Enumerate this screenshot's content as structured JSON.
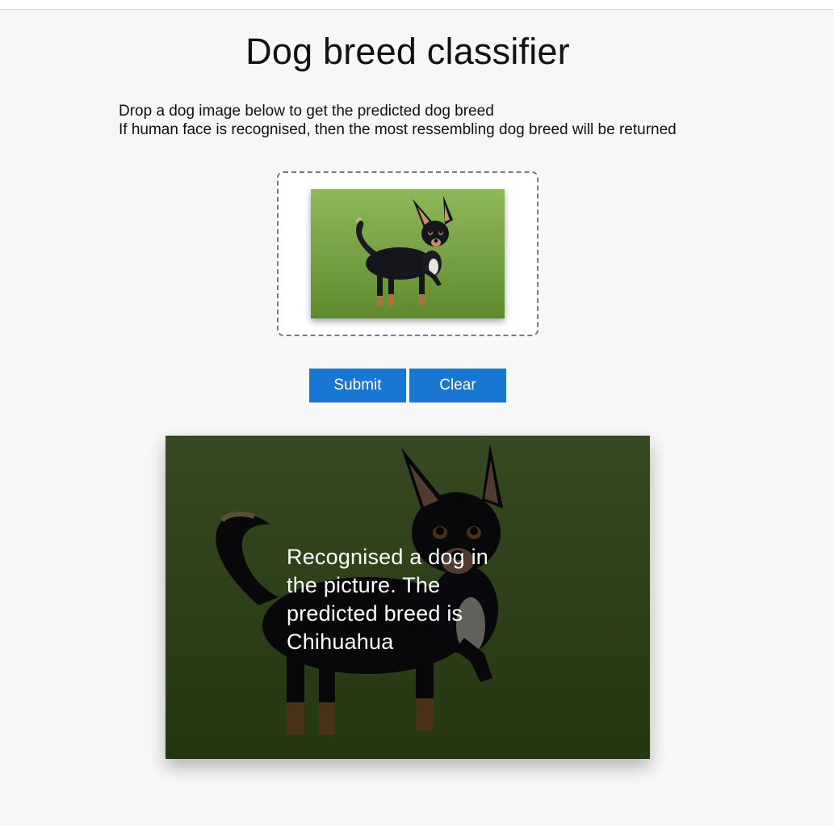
{
  "page": {
    "title": "Dog breed classifier",
    "instructions": [
      "Drop a dog image below to get the predicted dog breed",
      "If human face is recognised, then the most ressembling dog breed will be returned"
    ]
  },
  "dropzone": {
    "image_icon": "dog-photo"
  },
  "buttons": {
    "submit_label": "Submit",
    "clear_label": "Clear"
  },
  "result": {
    "message": "Recognised a dog in the picture. The predicted breed is Chihuahua"
  },
  "colors": {
    "accent": "#1976d2",
    "page_background": "#f7f7f7",
    "grass": "#6e9a3b"
  }
}
